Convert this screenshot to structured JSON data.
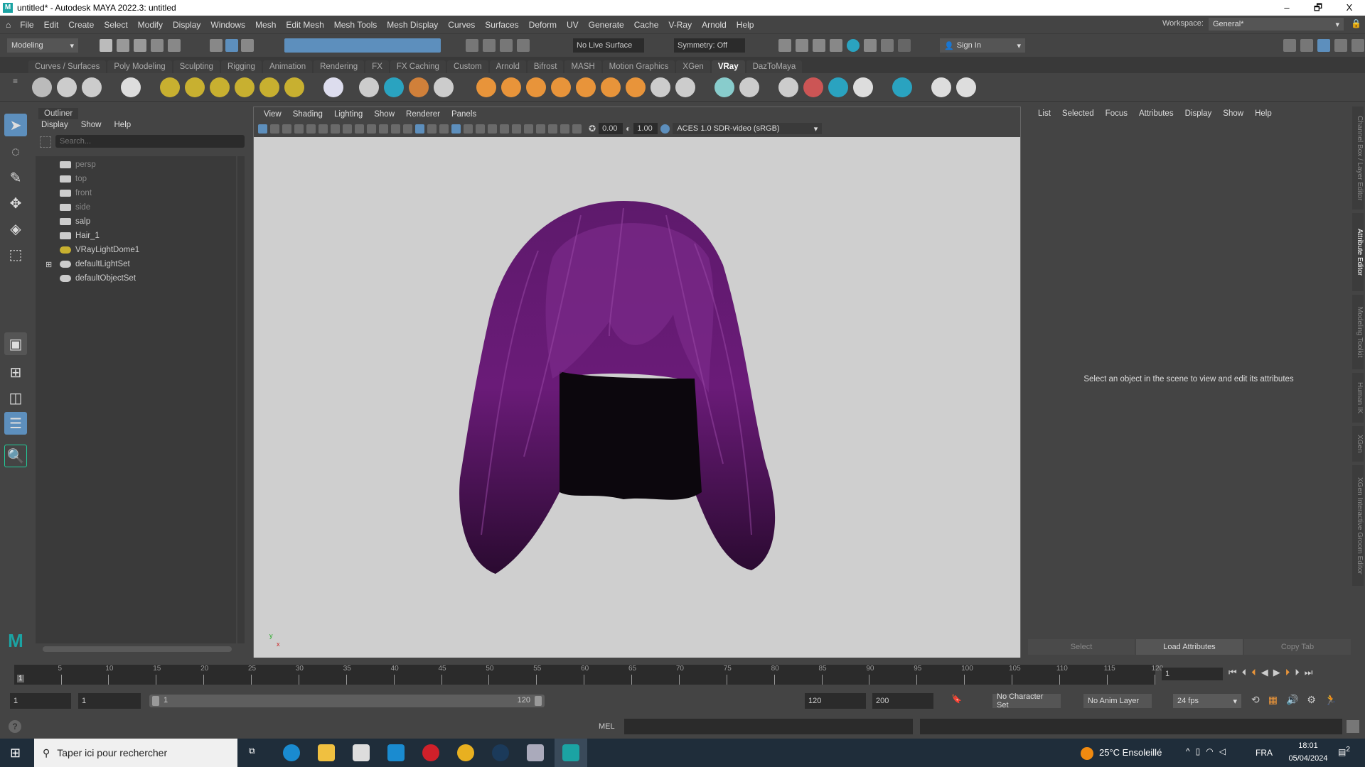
{
  "window": {
    "title": "untitled* - Autodesk MAYA 2022.3: untitled",
    "logo": "M",
    "minimize": "–",
    "maximize": "🗗",
    "close": "X"
  },
  "menus": [
    "File",
    "Edit",
    "Create",
    "Select",
    "Modify",
    "Display",
    "Windows",
    "Mesh",
    "Edit Mesh",
    "Mesh Tools",
    "Mesh Display",
    "Curves",
    "Surfaces",
    "Deform",
    "UV",
    "Generate",
    "Cache",
    "V-Ray",
    "Arnold",
    "Help"
  ],
  "workspace": {
    "label": "Workspace:",
    "value": "General*"
  },
  "status": {
    "mode": "Modeling",
    "live_surface": "No Live Surface",
    "symmetry": "Symmetry: Off",
    "sign_in": "Sign In"
  },
  "shelf_tabs": [
    "Curves / Surfaces",
    "Poly Modeling",
    "Sculpting",
    "Rigging",
    "Animation",
    "Rendering",
    "FX",
    "FX Caching",
    "Custom",
    "Arnold",
    "Bifrost",
    "MASH",
    "Motion Graphics",
    "XGen",
    "VRay",
    "DazToMaya"
  ],
  "shelf_active": "VRay",
  "outliner": {
    "title": "Outliner",
    "menu": [
      "Display",
      "Show",
      "Help"
    ],
    "search_placeholder": "Search...",
    "items": [
      {
        "name": "persp",
        "type": "camera",
        "dim": true
      },
      {
        "name": "top",
        "type": "camera",
        "dim": true
      },
      {
        "name": "front",
        "type": "camera",
        "dim": true
      },
      {
        "name": "side",
        "type": "camera",
        "dim": true
      },
      {
        "name": "salp",
        "type": "transform",
        "dim": false
      },
      {
        "name": "Hair_1",
        "type": "transform",
        "dim": false
      },
      {
        "name": "VRayLightDome1",
        "type": "light",
        "dim": false
      },
      {
        "name": "defaultLightSet",
        "type": "set",
        "dim": false,
        "expandable": true,
        "expand": "⊞"
      },
      {
        "name": "defaultObjectSet",
        "type": "set",
        "dim": false
      }
    ]
  },
  "viewport": {
    "menu": [
      "View",
      "Shading",
      "Lighting",
      "Show",
      "Renderer",
      "Panels"
    ],
    "exposure": "0.00",
    "gamma": "1.00",
    "colorspace": "ACES 1.0 SDR-video (sRGB)",
    "axis_y": "y",
    "axis_x": "x"
  },
  "attribute_editor": {
    "menu": [
      "List",
      "Selected",
      "Focus",
      "Attributes",
      "Display",
      "Show",
      "Help"
    ],
    "message": "Select an object in the scene to view and edit its attributes",
    "buttons": [
      "Select",
      "Load Attributes",
      "Copy Tab"
    ]
  },
  "side_tabs": [
    "Channel Box / Layer Editor",
    "Attribute Editor",
    "Modeling Toolkit",
    "Human IK",
    "XGen",
    "XGen Interactive Groom Editor"
  ],
  "timeline": {
    "ticks": [
      "5",
      "10",
      "15",
      "20",
      "25",
      "30",
      "35",
      "40",
      "45",
      "50",
      "55",
      "60",
      "65",
      "70",
      "75",
      "80",
      "85",
      "90",
      "95",
      "100",
      "105",
      "110",
      "115",
      "120"
    ],
    "current_marker": "1",
    "current_frame": "1"
  },
  "range": {
    "start": "1",
    "anim_start": "1",
    "range_start": "1",
    "range_end": "120",
    "end": "120",
    "anim_end": "200",
    "character_set": "No Character Set",
    "anim_layer": "No Anim Layer",
    "fps": "24 fps"
  },
  "command": {
    "lang": "MEL",
    "help": "?"
  },
  "taskbar": {
    "search_placeholder": "Taper ici pour rechercher",
    "weather": "25°C  Ensoleillé",
    "lang": "FRA",
    "time": "18:01",
    "date": "05/04/2024",
    "notifications": "2"
  },
  "colors": {
    "accent": "#5d8fbd",
    "hair": "#5a1466",
    "viewport_bg": "#cfcfcf",
    "panel": "#444444"
  }
}
